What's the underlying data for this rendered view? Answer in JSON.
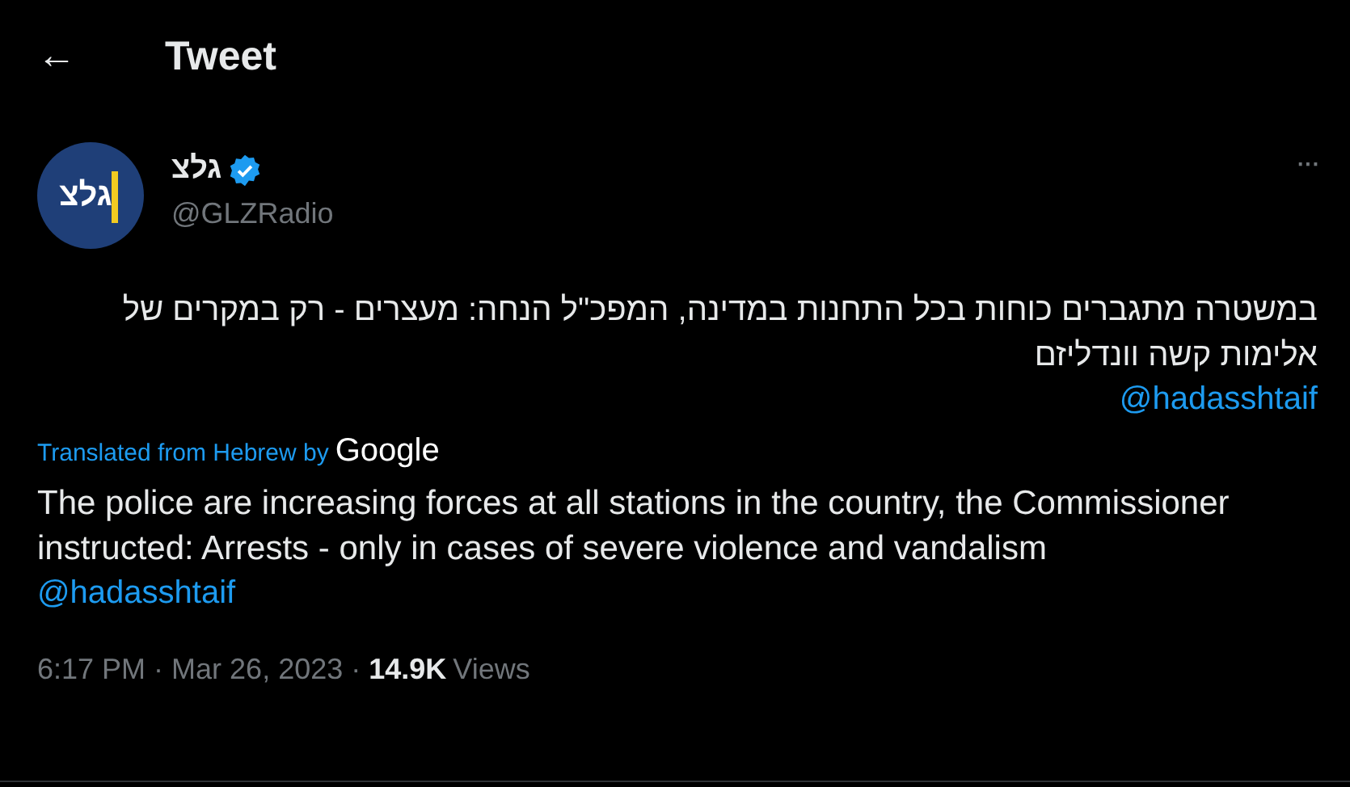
{
  "header": {
    "back": "←",
    "title": "Tweet"
  },
  "author": {
    "avatar_text": "גלצ",
    "name": "גלצ",
    "verified": true,
    "handle": "@GLZRadio",
    "more": "···"
  },
  "original_text": [
    "במשטרה מתגברים כוחות בכל התחנות במדינה, המפכ\"ל הנחה: מעצרים - רק במקרים של אלימות קשה וונדליזם",
    "@hadasshtaif"
  ],
  "translation": {
    "label": "Translated from Hebrew by",
    "provider": "Google",
    "text": "The police are increasing forces at all stations in the country, the Commissioner instructed: Arrests - only in cases of severe violence and vandalism",
    "mention": "@hadasshtaif"
  },
  "meta": {
    "time": "6:17 PM",
    "separator_1": "·",
    "date": "Mar 26, 2023",
    "separator_2": "·",
    "views_count": "14.9K",
    "views_label": "Views"
  }
}
